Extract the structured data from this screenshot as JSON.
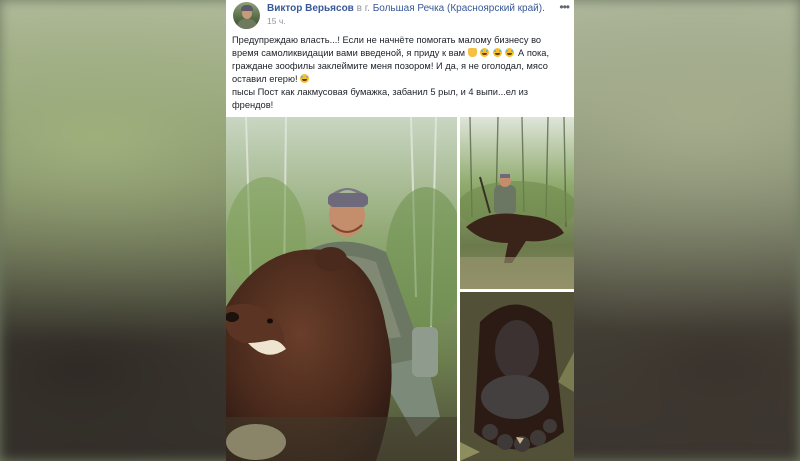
{
  "post": {
    "author": "Виктор Верьясов",
    "location_prefix": "в г.",
    "location": "Большая Речка (Красноярский край).",
    "timestamp": "15 ч.",
    "more_icon": "more-horizontal-icon",
    "text_line1": "Предупреждаю власть...! Если не начнёте помогать малому бизнесу во время самоликвидации вами введеной, я приду к вам",
    "text_line1_cont": "А пока, граждане зоофилы заклеймите меня позором! И да, я не оголодал, мясо оставил егерю!",
    "text_line2": "пысы Пост как лакмусовая бумажка, забанил 5 рыл, и 4 выпи...ел из френдов!",
    "emojis": [
      "pointing-hand-emoji",
      "tears-of-joy-emoji",
      "tears-of-joy-emoji",
      "tears-of-joy-emoji",
      "tears-of-joy-emoji"
    ]
  },
  "photos": [
    {
      "name": "hunter-with-bear-photo"
    },
    {
      "name": "hunter-standing-over-bear-photo"
    },
    {
      "name": "bear-paw-photo"
    }
  ],
  "colors": {
    "link": "#385898",
    "text": "#1d2129",
    "meta": "#90949c",
    "card": "#ffffff"
  }
}
